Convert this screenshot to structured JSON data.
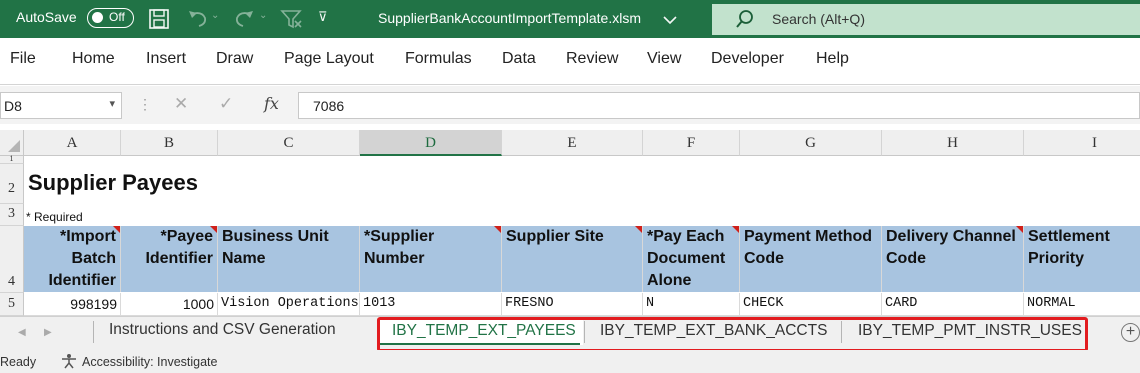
{
  "titlebar": {
    "autosave_label": "AutoSave",
    "autosave_state": "Off",
    "filename": "SupplierBankAccountImportTemplate.xlsm",
    "search_placeholder": "Search (Alt+Q)",
    "icons": [
      "save-icon",
      "undo-icon",
      "redo-icon",
      "filter-icon",
      "customize-icon"
    ]
  },
  "menu": [
    "File",
    "Home",
    "Insert",
    "Draw",
    "Page Layout",
    "Formulas",
    "Data",
    "Review",
    "View",
    "Developer",
    "Help"
  ],
  "formula_bar": {
    "name_box": "D8",
    "formula": "7086"
  },
  "grid": {
    "columns": [
      "A",
      "B",
      "C",
      "D",
      "E",
      "F",
      "G",
      "H",
      "I"
    ],
    "selected_column": "D",
    "rows": [
      "1",
      "2",
      "3",
      "4",
      "5"
    ],
    "title": "Supplier Payees",
    "required_note": "* Required",
    "headers": [
      "*Import Batch Identifier",
      "*Payee Identifier",
      "Business Unit Name",
      "*Supplier Number",
      "Supplier Site",
      "*Pay Each Document Alone",
      "Payment Method Code",
      "Delivery Channel Code",
      "Settlement Priority"
    ],
    "row5": [
      "998199",
      "1000",
      "Vision Operations",
      "1013",
      "FRESNO",
      "N",
      "CHECK",
      "CARD",
      "NORMAL"
    ]
  },
  "sheet_tabs": {
    "tabs": [
      "Instructions and CSV Generation",
      "IBY_TEMP_EXT_PAYEES",
      "IBY_TEMP_EXT_BANK_ACCTS",
      "IBY_TEMP_PMT_INSTR_USES"
    ],
    "active": "IBY_TEMP_EXT_PAYEES",
    "highlight_color": "#e21b1f"
  },
  "status": {
    "ready": "Ready",
    "accessibility": "Accessibility: Investigate"
  },
  "colors": {
    "excel_green": "#217346",
    "header_fill": "#a8c4e0"
  }
}
